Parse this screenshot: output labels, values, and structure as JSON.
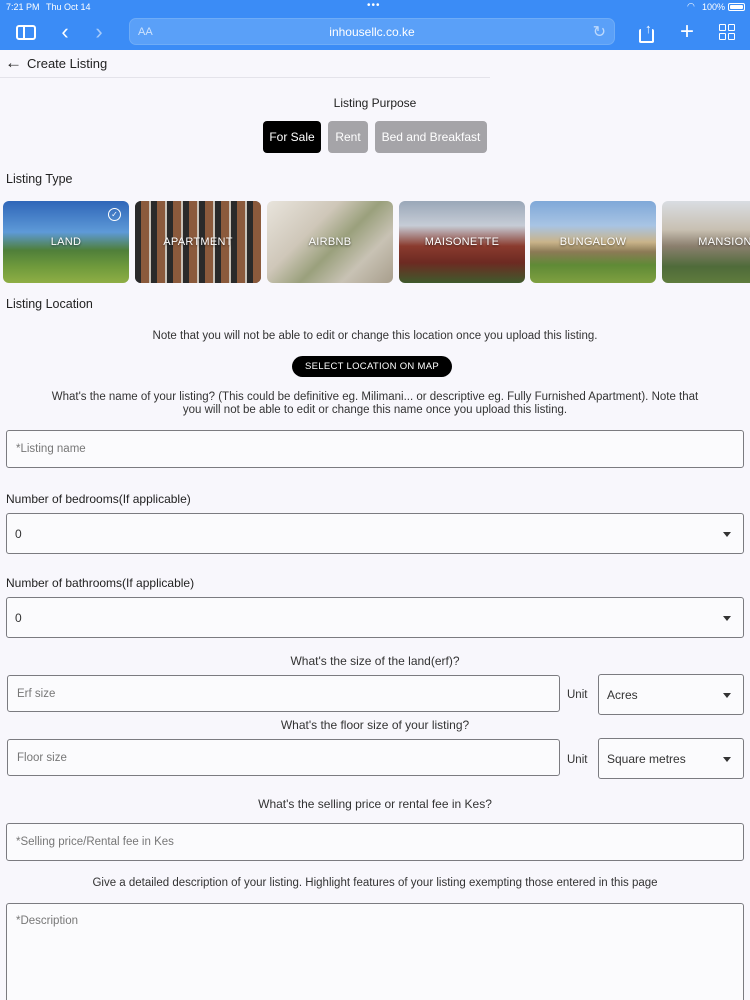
{
  "status_bar": {
    "time": "7:21 PM",
    "date": "Thu Oct 14",
    "battery": "100%"
  },
  "browser": {
    "text_size": "AA",
    "url": "inhousellc.co.ke"
  },
  "header": {
    "title": "Create Listing"
  },
  "listing_purpose": {
    "title": "Listing Purpose",
    "options": [
      "For Sale",
      "Rent",
      "Bed and Breakfast"
    ],
    "selected": "For Sale"
  },
  "listing_type": {
    "title": "Listing Type",
    "options": [
      "LAND",
      "APARTMENT",
      "AIRBNB",
      "MAISONETTE",
      "BUNGALOW",
      "MANSION"
    ],
    "selected": "LAND"
  },
  "listing_location": {
    "title": "Listing Location",
    "note": "Note that you will not be able to edit or change this location once you upload this listing.",
    "map_button": "SELECT LOCATION ON MAP"
  },
  "listing_name": {
    "question_line1": "What's the name of your listing? (This could be definitive eg. Milimani... or descriptive eg. Fully Furnished Apartment). Note that",
    "question_line2": "you will not be able to edit or change this name once you upload this listing.",
    "placeholder": "*Listing name"
  },
  "bedrooms": {
    "label": "Number of bedrooms(If applicable)",
    "value": "0"
  },
  "bathrooms": {
    "label": "Number of bathrooms(If applicable)",
    "value": "0"
  },
  "land_size": {
    "question": "What's the size of the land(erf)?",
    "placeholder": "Erf size",
    "unit_label": "Unit",
    "unit_value": "Acres"
  },
  "floor_size": {
    "question": "What's the floor size of your listing?",
    "placeholder": "Floor size",
    "unit_label": "Unit",
    "unit_value": "Square metres"
  },
  "price": {
    "question": "What's the selling price or rental fee in Kes?",
    "placeholder": "*Selling price/Rental fee in Kes"
  },
  "description": {
    "question": "Give a detailed description of your listing. Highlight features of your listing exempting those entered in this page",
    "placeholder": "*Description"
  },
  "colors": {
    "browser_bar": "#3b8cf6",
    "active_chip": "#000000",
    "inactive_chip": "#a5a4a8",
    "page_bg": "#f8f7fc"
  }
}
